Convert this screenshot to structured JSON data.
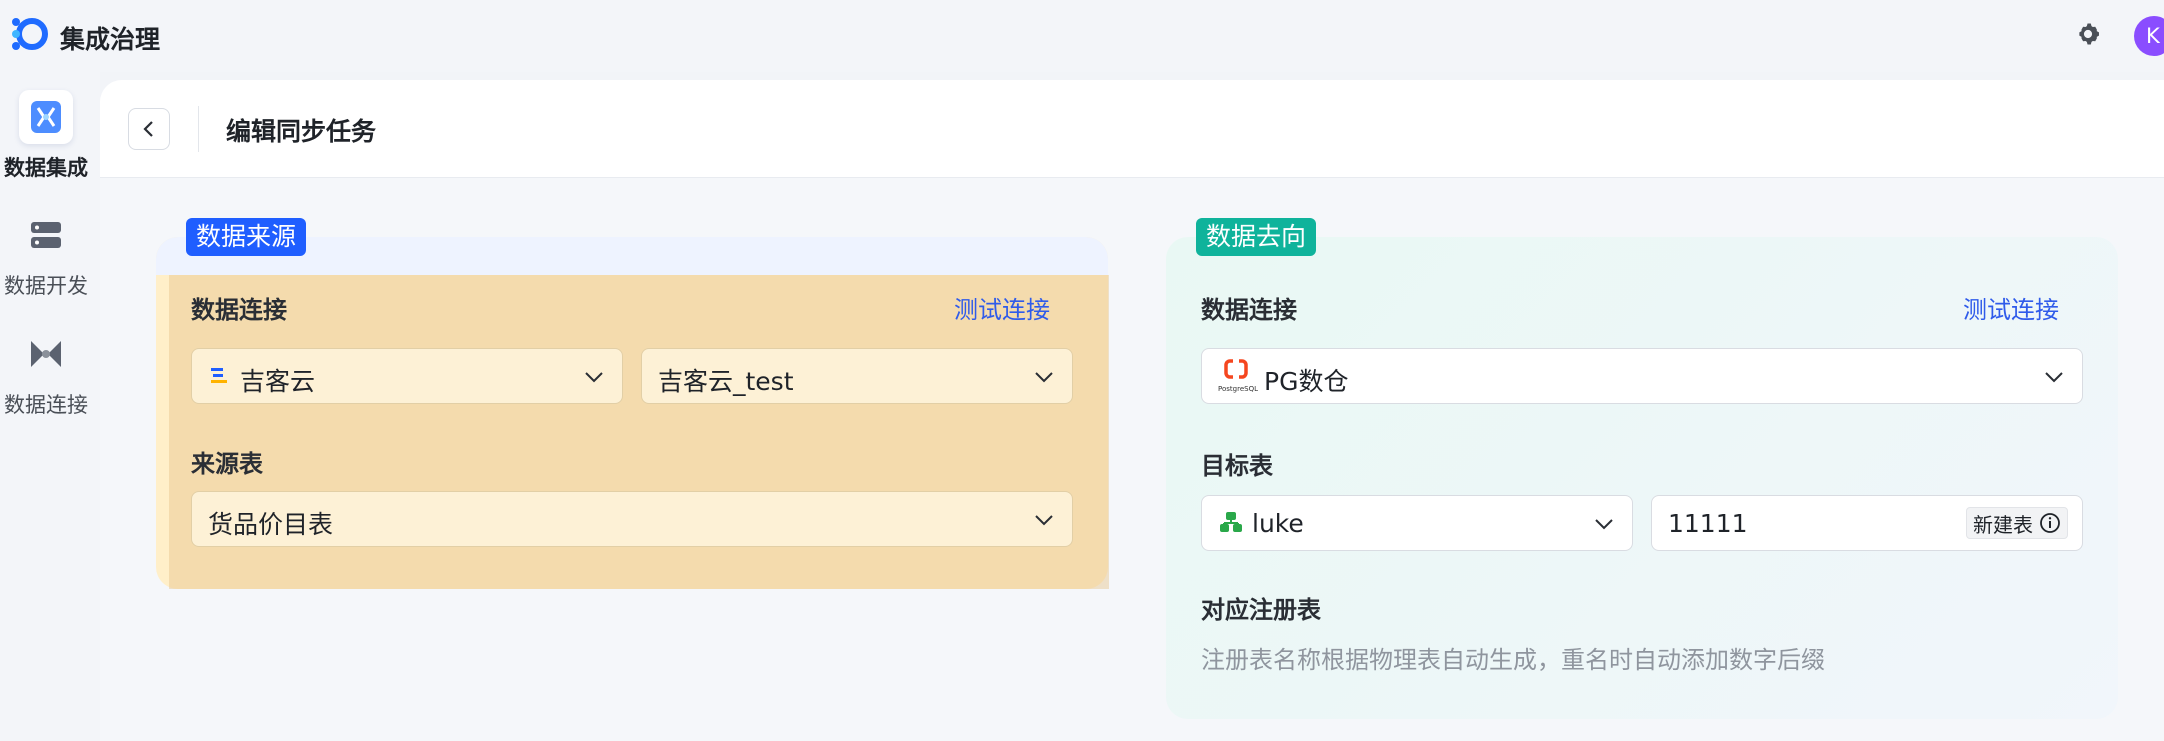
{
  "app": {
    "title": "集成治理",
    "avatar_initial": "K"
  },
  "nav": {
    "items": [
      {
        "label": "数据集成",
        "icon": "data-integration-icon",
        "active": true
      },
      {
        "label": "数据开发",
        "icon": "data-dev-icon",
        "active": false
      },
      {
        "label": "数据连接",
        "icon": "data-connection-icon",
        "active": false
      }
    ]
  },
  "page": {
    "title": "编辑同步任务"
  },
  "source": {
    "tag": "数据来源",
    "connection_label": "数据连接",
    "test_link": "测试连接",
    "connection_value": "吉客云",
    "instance_value": "吉客云_test",
    "table_label": "来源表",
    "table_value": "货品价目表"
  },
  "destination": {
    "tag": "数据去向",
    "connection_label": "数据连接",
    "test_link": "测试连接",
    "connection_value": "PG数仓",
    "connection_logo_text": "PostgreSQL",
    "target_label": "目标表",
    "schema_value": "luke",
    "table_value": "11111",
    "new_table_button": "新建表",
    "registry_label": "对应注册表",
    "registry_hint": "注册表名称根据物理表自动生成，重名时自动添加数字后缀"
  },
  "colors": {
    "primary": "#1f5eff",
    "teal": "#0fb39b",
    "link": "#2f5bea",
    "avatar": "#8a4dff"
  }
}
